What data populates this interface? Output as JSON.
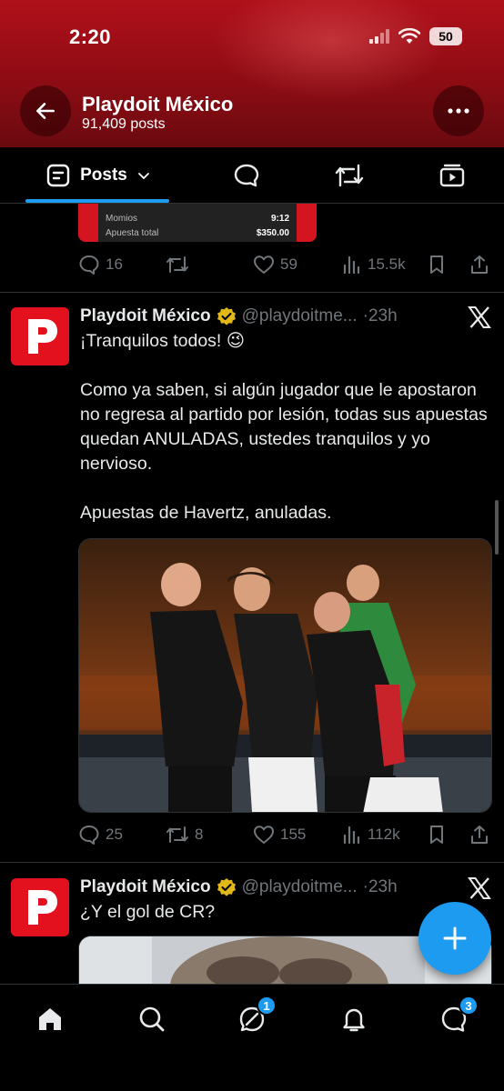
{
  "status_bar": {
    "time": "2:20",
    "battery": "50"
  },
  "header": {
    "title": "Playdoit México",
    "subtitle": "91,409 posts"
  },
  "tabs": {
    "posts_label": "Posts"
  },
  "previous_post": {
    "card_rows": [
      {
        "label": "Momios",
        "value": "9:12"
      },
      {
        "label": "Apuesta total",
        "value": "$350.00"
      }
    ],
    "replies": "16",
    "reposts": "",
    "likes": "59",
    "views": "15.5k"
  },
  "posts": [
    {
      "name": "Playdoit México",
      "handle": "@playdoitme...",
      "time": "·23h",
      "text": [
        "¡Tranquilos todos! 😉",
        "",
        "Como ya saben, si algún jugador que le apostaron no regresa al partido por lesión, todas sus apuestas quedan ANULADAS, ustedes tranquilos y yo nervioso.",
        "",
        "Apuestas de Havertz, anuladas."
      ],
      "replies": "25",
      "reposts": "8",
      "likes": "155",
      "views": "112k"
    },
    {
      "name": "Playdoit México",
      "handle": "@playdoitme...",
      "time": "·23h",
      "text": [
        "¿Y el gol de CR?"
      ]
    }
  ],
  "bottom_nav": {
    "grok_badge": "1",
    "messages_badge": "3"
  },
  "colors": {
    "accent": "#1d9bf0",
    "brand_red": "#e3101d",
    "verified_gold": "#e2b719"
  }
}
